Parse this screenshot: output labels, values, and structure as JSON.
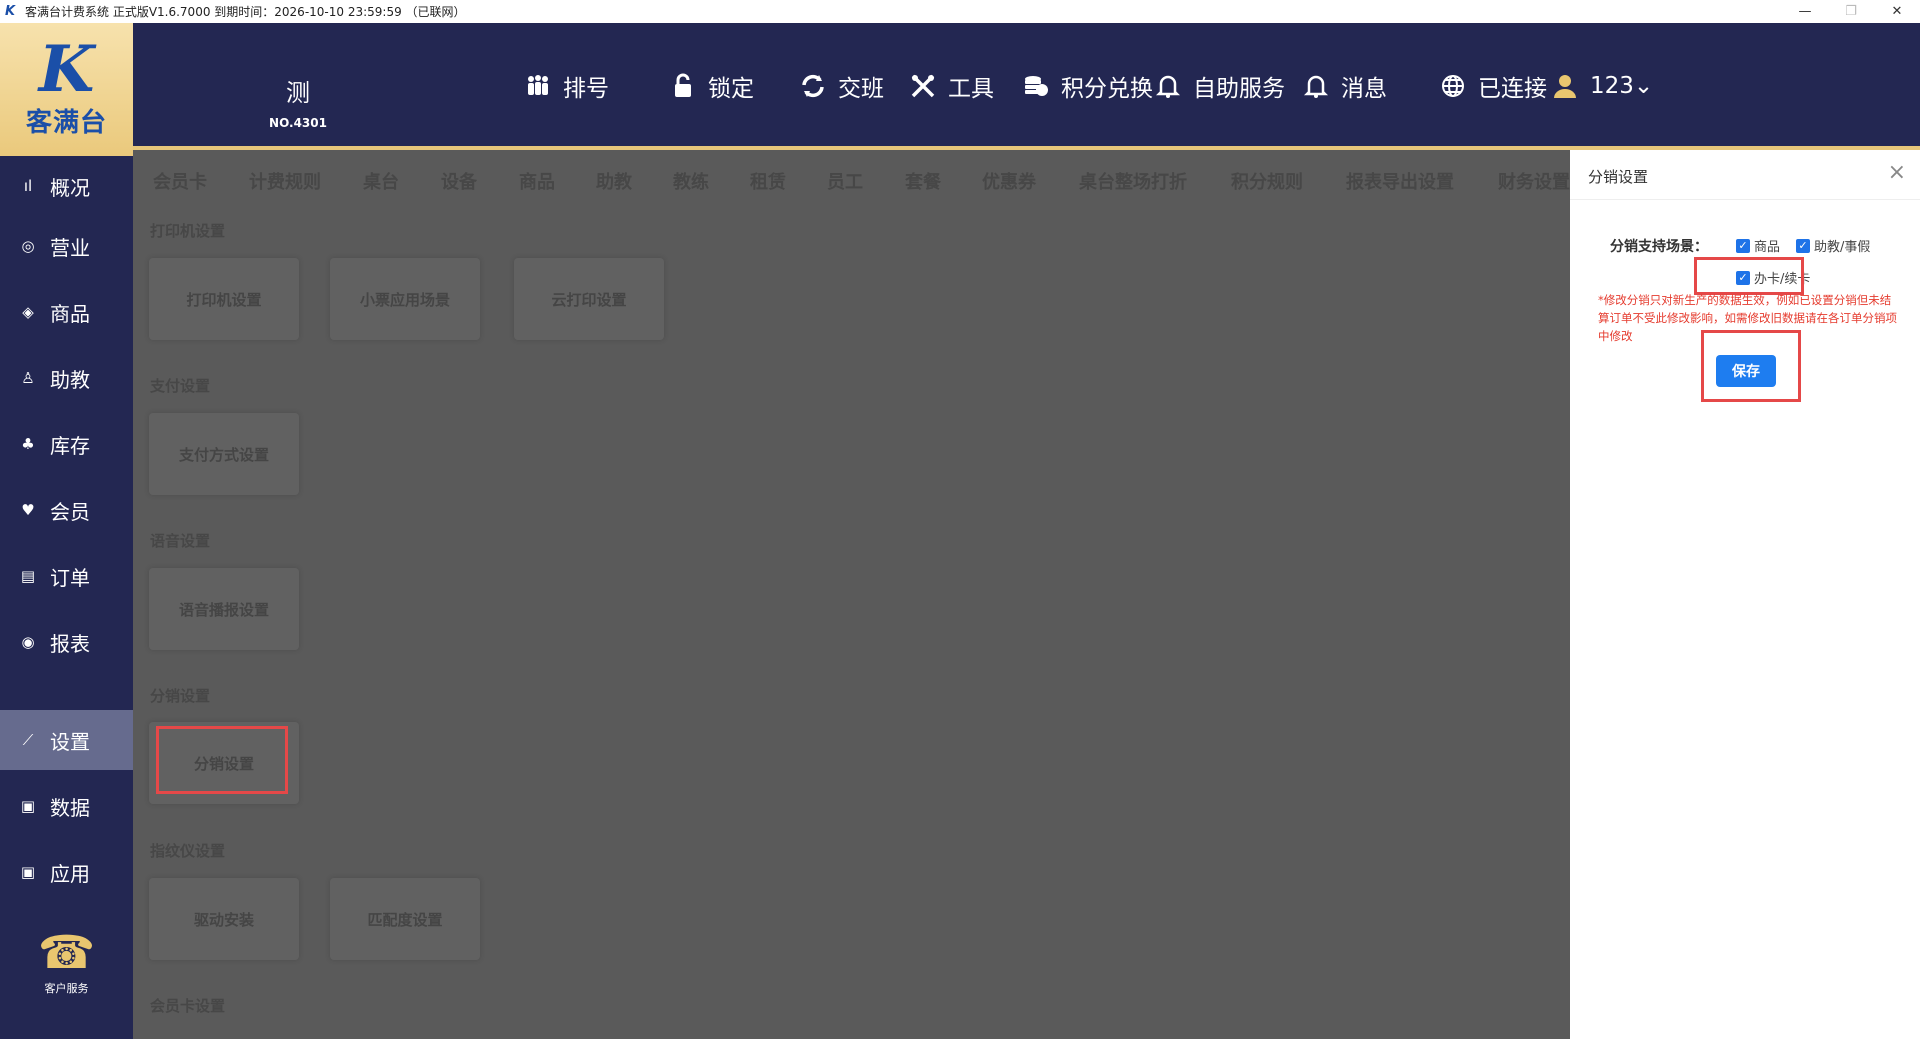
{
  "window": {
    "title": "客满台计费系统 正式版V1.6.7000 到期时间：2026-10-10 23:59:59 （已联网）",
    "minimize": "—",
    "restore": "❐",
    "close": "✕"
  },
  "logo": {
    "mark": "K",
    "text": "客满台"
  },
  "store": {
    "name": "测",
    "number": "NO.4301"
  },
  "topnav": [
    {
      "label": "排号",
      "icon": "queue-icon"
    },
    {
      "label": "锁定",
      "icon": "lock-icon"
    },
    {
      "label": "交班",
      "icon": "shift-icon"
    },
    {
      "label": "工具",
      "icon": "tools-icon"
    },
    {
      "label": "积分兑换",
      "icon": "coins-icon"
    },
    {
      "label": "自助服务",
      "icon": "bell-icon"
    },
    {
      "label": "消息",
      "icon": "bell-icon"
    },
    {
      "label": "已连接",
      "icon": "globe-icon"
    },
    {
      "label": "123⌄",
      "icon": "user-icon"
    }
  ],
  "sidebar": {
    "items": [
      {
        "label": "概况",
        "icon": "ıl"
      },
      {
        "label": "营业",
        "icon": "◎"
      },
      {
        "label": "商品",
        "icon": "◈"
      },
      {
        "label": "助教",
        "icon": "♙"
      },
      {
        "label": "库存",
        "icon": "♣"
      },
      {
        "label": "会员",
        "icon": "♥"
      },
      {
        "label": "订单",
        "icon": "▤"
      },
      {
        "label": "报表",
        "icon": "◉"
      },
      {
        "label": "设置",
        "icon": "⟋"
      },
      {
        "label": "数据",
        "icon": "▣"
      },
      {
        "label": "应用",
        "icon": "▣"
      }
    ],
    "service": {
      "icon": "☎",
      "label": "客户服务"
    }
  },
  "tabs": [
    "会员卡",
    "计费规则",
    "桌台",
    "设备",
    "商品",
    "助教",
    "教练",
    "租赁",
    "员工",
    "套餐",
    "优惠券",
    "桌台整场打折",
    "积分规则",
    "报表导出设置",
    "财务设置"
  ],
  "sections": [
    {
      "title": "打印机设置",
      "cards": [
        "打印机设置",
        "小票应用场景",
        "云打印设置"
      ]
    },
    {
      "title": "支付设置",
      "cards": [
        "支付方式设置"
      ]
    },
    {
      "title": "语音设置",
      "cards": [
        "语音播报设置"
      ]
    },
    {
      "title": "分销设置",
      "cards": [
        "分销设置"
      ]
    },
    {
      "title": "指纹仪设置",
      "cards": [
        "驱动安装",
        "匹配度设置"
      ]
    },
    {
      "title": "会员卡设置",
      "cards": []
    }
  ],
  "drawer": {
    "title": "分销设置",
    "close": "×",
    "scene_label": "分销支持场景：",
    "options": [
      {
        "label": "商品",
        "checked": true
      },
      {
        "label": "助教/事假",
        "checked": true
      },
      {
        "label": "办卡/续卡",
        "checked": true
      }
    ],
    "notice": "*修改分销只对新生产的数据生效，例如已设置分销但未结算订单不受此修改影响，如需修改旧数据请在各订单分销项中修改",
    "save_label": "保存"
  },
  "colors": {
    "nav_bg": "#232752",
    "accent_gold": "#e7c67a",
    "active_item": "#666b8e",
    "primary_blue": "#1e7df0",
    "notice_red": "#e53b2e",
    "highlight_red": "#e54848"
  }
}
